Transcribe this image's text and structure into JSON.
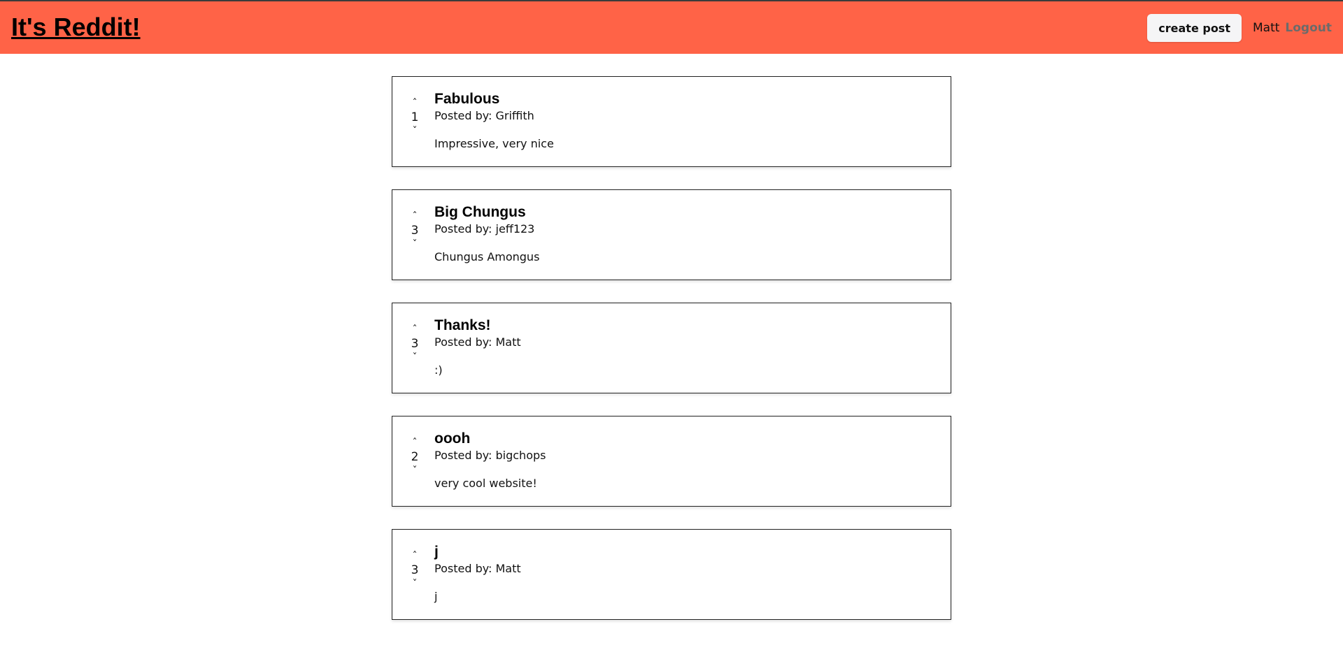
{
  "header": {
    "brand": "It's Reddit!",
    "create_post_label": "create post",
    "username": "Matt",
    "logout_label": "Logout"
  },
  "colors": {
    "navbar_bg": "#ff6347",
    "logout_text": "#6b6b6b"
  },
  "posted_by_prefix": "Posted by: ",
  "vote_icons": {
    "up": "chevron-up-icon",
    "down": "chevron-down-icon"
  },
  "posts": [
    {
      "votes": "1",
      "title": "Fabulous",
      "author": "Griffith",
      "body": "Impressive, very nice"
    },
    {
      "votes": "3",
      "title": "Big Chungus",
      "author": "jeff123",
      "body": "Chungus Amongus"
    },
    {
      "votes": "3",
      "title": "Thanks!",
      "author": "Matt",
      "body": ":)"
    },
    {
      "votes": "2",
      "title": "oooh",
      "author": "bigchops",
      "body": "very cool website!"
    },
    {
      "votes": "3",
      "title": "j",
      "author": "Matt",
      "body": "j"
    }
  ]
}
